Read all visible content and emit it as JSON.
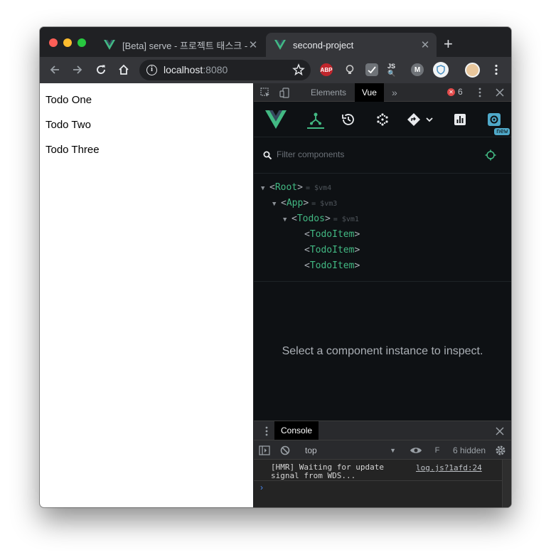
{
  "browser": {
    "tabs": [
      {
        "title": "[Beta] serve - 프로젝트 태스크 - Vi",
        "active": false
      },
      {
        "title": "second-project",
        "active": true
      }
    ],
    "new_tab": "+",
    "close_glyph": "✕",
    "url_host": "localhost",
    "url_port": ":8080",
    "info_glyph": "i",
    "extensions": [
      "ABP",
      "lightbulb",
      "checkmark",
      "JS-search",
      "M",
      "shield"
    ]
  },
  "page": {
    "todos": [
      "Todo One",
      "Todo Two",
      "Todo Three"
    ]
  },
  "devtools": {
    "tabs": [
      "Elements",
      "Vue"
    ],
    "more_tabs": "»",
    "error_count": "6",
    "error_glyph": "✕",
    "vue": {
      "filter_placeholder": "Filter components",
      "new_badge": "new",
      "tree": [
        {
          "name": "Root",
          "vm": "= $vm4",
          "expanded": true
        },
        {
          "name": "App",
          "vm": "= $vm3",
          "expanded": true
        },
        {
          "name": "Todos",
          "vm": "= $vm1",
          "expanded": true
        },
        {
          "name": "TodoItem"
        },
        {
          "name": "TodoItem"
        },
        {
          "name": "TodoItem"
        }
      ],
      "inspect_message": "Select a component instance to inspect."
    },
    "console": {
      "tab_label": "Console",
      "context": "top",
      "hidden": "6 hidden",
      "log_message": "[HMR] Waiting for update signal from WDS...",
      "log_source": "log.js?1afd:24",
      "prompt": "›"
    }
  },
  "colors": {
    "vue_green": "#42b983",
    "devtools_bg": "#0e1114",
    "chrome_tab_bg": "#35363a"
  }
}
